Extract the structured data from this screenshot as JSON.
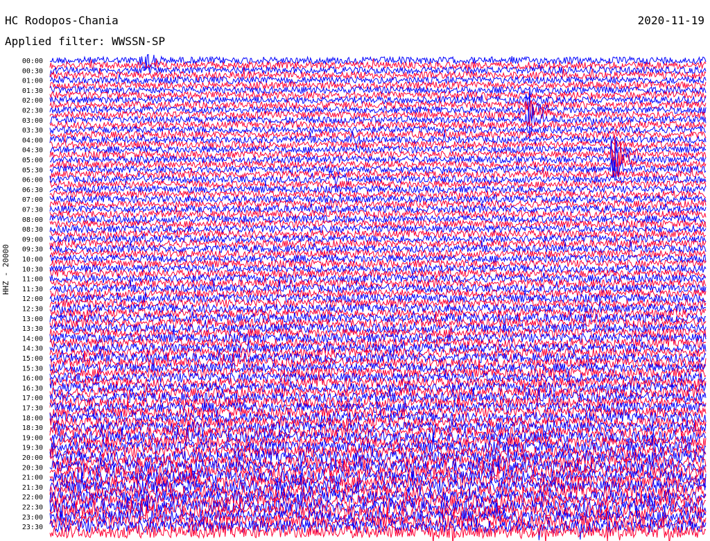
{
  "header": {
    "station": "HC Rodopos-Chania",
    "date": "2020-11-19",
    "filter_label": "Applied filter: WWSSN-SP"
  },
  "chart_data": {
    "type": "line",
    "title": "HC Rodopos-Chania",
    "subtitle": "Applied filter: WWSSN-SP",
    "date": "2020-11-19",
    "ylabel": "HHZ - 20000",
    "row_interval_minutes": 15,
    "series_colors": [
      "#0000ff",
      "#ff0033"
    ],
    "time_labels": [
      "00:00",
      "00:30",
      "01:00",
      "01:30",
      "02:00",
      "02:30",
      "03:00",
      "03:30",
      "04:00",
      "04:30",
      "05:00",
      "05:30",
      "06:00",
      "06:30",
      "07:00",
      "07:30",
      "08:00",
      "08:30",
      "09:00",
      "09:30",
      "10:00",
      "10:30",
      "11:00",
      "11:30",
      "12:00",
      "12:30",
      "13:00",
      "13:30",
      "14:00",
      "14:30",
      "15:00",
      "15:30",
      "16:00",
      "16:30",
      "17:00",
      "17:30",
      "18:00",
      "18:30",
      "19:00",
      "19:30",
      "20:00",
      "20:30",
      "21:00",
      "21:30",
      "22:00",
      "22:30",
      "23:00",
      "23:30"
    ],
    "rows": 96,
    "noise_level_by_hour": [
      0.3,
      0.3,
      0.3,
      0.3,
      0.3,
      0.3,
      0.32,
      0.33,
      0.35,
      0.35,
      0.38,
      0.42,
      0.48,
      0.55,
      0.58,
      0.62,
      0.65,
      0.7,
      0.75,
      0.85,
      0.95,
      1.0,
      1.0,
      1.0
    ],
    "events": [
      {
        "row": 0,
        "x_fraction": 0.14,
        "amplitude": 2.5
      },
      {
        "row": 10,
        "x_fraction": 0.73,
        "amplitude": 3.0
      },
      {
        "row": 11,
        "x_fraction": 0.73,
        "amplitude": 3.5
      },
      {
        "row": 12,
        "x_fraction": 0.73,
        "amplitude": 2.8
      },
      {
        "row": 16,
        "x_fraction": 0.46,
        "amplitude": 1.8
      },
      {
        "row": 19,
        "x_fraction": 0.86,
        "amplitude": 3.5
      },
      {
        "row": 20,
        "x_fraction": 0.86,
        "amplitude": 4.0
      },
      {
        "row": 21,
        "x_fraction": 0.86,
        "amplitude": 3.2
      },
      {
        "row": 22,
        "x_fraction": 0.86,
        "amplitude": 2.0
      },
      {
        "row": 24,
        "x_fraction": 0.43,
        "amplitude": 2.0
      }
    ]
  }
}
